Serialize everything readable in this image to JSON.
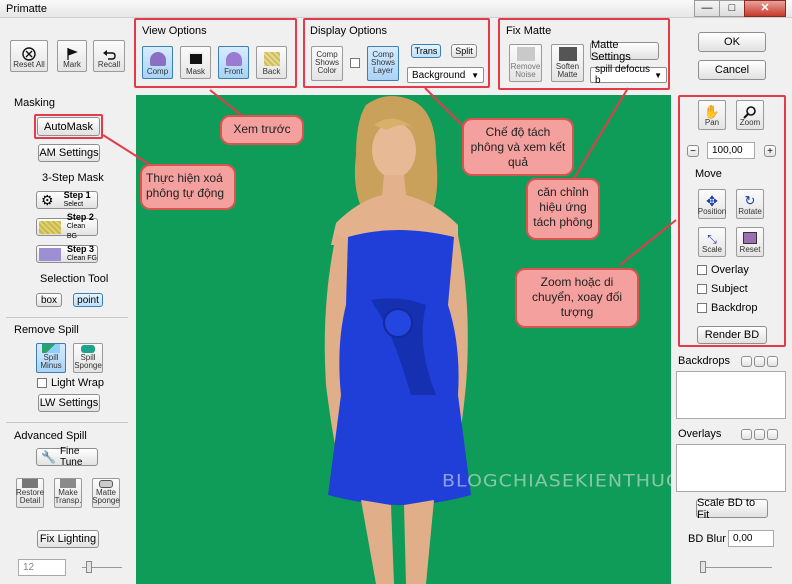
{
  "window": {
    "title": "Primatte",
    "min": "—",
    "max": "□",
    "close": "✕"
  },
  "toolbar": {
    "reset_all": "Reset All",
    "mark": "Mark",
    "recall": "Recall"
  },
  "masking": {
    "header": "Masking",
    "automask": "AutoMask",
    "am_settings": "AM Settings",
    "three_step": "3-Step Mask",
    "step1": "Step 1",
    "step1_sub": "Select",
    "step2": "Step 2",
    "step2_sub": "Clean BG",
    "step3": "Step 3",
    "step3_sub": "Clean FG",
    "selection_tool": "Selection Tool",
    "box": "box",
    "point": "point"
  },
  "remove_spill": {
    "header": "Remove Spill",
    "spill_minus": "Spill Minus",
    "spill_sponge": "Spill Sponge",
    "light_wrap": "Light Wrap",
    "lw_settings": "LW Settings"
  },
  "advanced_spill": {
    "header": "Advanced Spill",
    "fine_tune": "Fine Tune",
    "restore_detail": "Restore Detail",
    "make_transp": "Make Transp.",
    "matte_sponge": "Matte Sponge"
  },
  "fix_lighting": "Fix Lighting",
  "bottom_left_value": "12",
  "view_options": {
    "header": "View Options",
    "comp": "Comp",
    "mask": "Mask",
    "front": "Front",
    "back": "Back"
  },
  "display_options": {
    "header": "Display Options",
    "comp_shows_color": "Comp Shows Color",
    "comp_shows_layer": "Comp Shows Layer",
    "trans": "Trans",
    "split": "Split",
    "background": "Background"
  },
  "fix_matte": {
    "header": "Fix Matte",
    "remove_noise": "Remove Noise",
    "soften_matte": "Soften Matte",
    "matte_settings": "Matte Settings",
    "spill_select": "spill defocus b"
  },
  "actions": {
    "ok": "OK",
    "cancel": "Cancel"
  },
  "transform": {
    "pan": "Pan",
    "zoom": "Zoom",
    "minus": "−",
    "plus": "+",
    "zoom_value": "100,00",
    "move": "Move",
    "position": "Position",
    "rotate": "Rotate",
    "scale": "Scale",
    "reset": "Reset",
    "overlay": "Overlay",
    "subject": "Subject",
    "backdrop": "Backdrop",
    "render_bd": "Render BD"
  },
  "backdrops": "Backdrops",
  "overlays": "Overlays",
  "scale_bd_to_fit": "Scale BD to Fit",
  "bd_blur": {
    "label": "BD Blur",
    "value": "0,00"
  },
  "watermark": "BLOGCHIASEKIENTHUC.COM",
  "callouts": {
    "preview": "Xem trước",
    "auto_remove": "Thực hiện xoá phông tự động",
    "mode": "Chế độ tách phông và xem kết quả",
    "align": "căn chỉnh hiệu ứng tách phông",
    "zoom_move": "Zoom hoặc di chuyển, xoay đối tượng"
  },
  "colors": {
    "green_screen": "#0f9c58",
    "dress": "#1f3fd8",
    "callout_fill": "#f3a09e",
    "callout_border": "#d9534f",
    "highlight": "#e53a4a"
  }
}
